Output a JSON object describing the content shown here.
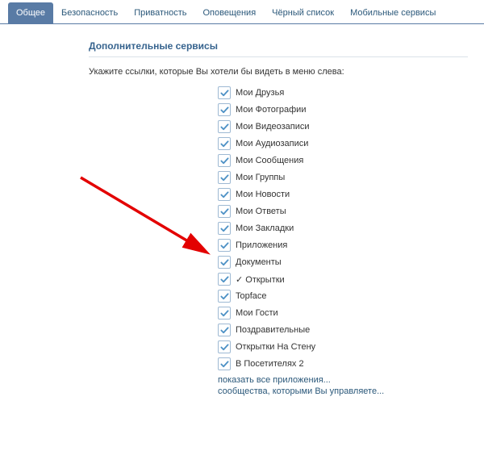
{
  "tabs": [
    {
      "label": "Общее",
      "active": true
    },
    {
      "label": "Безопасность",
      "active": false
    },
    {
      "label": "Приватность",
      "active": false
    },
    {
      "label": "Оповещения",
      "active": false
    },
    {
      "label": "Чёрный список",
      "active": false
    },
    {
      "label": "Мобильные сервисы",
      "active": false
    }
  ],
  "section_title": "Дополнительные сервисы",
  "hint": "Укажите ссылки, которые Вы хотели бы видеть в меню слева:",
  "items": [
    {
      "label": "Мои Друзья",
      "checked": true
    },
    {
      "label": "Мои Фотографии",
      "checked": true
    },
    {
      "label": "Мои Видеозаписи",
      "checked": true
    },
    {
      "label": "Мои Аудиозаписи",
      "checked": true
    },
    {
      "label": "Мои Сообщения",
      "checked": true
    },
    {
      "label": "Мои Группы",
      "checked": true
    },
    {
      "label": "Мои Новости",
      "checked": true
    },
    {
      "label": "Мои Ответы",
      "checked": true
    },
    {
      "label": "Мои Закладки",
      "checked": true
    },
    {
      "label": "Приложения",
      "checked": true
    },
    {
      "label": "Документы",
      "checked": true
    },
    {
      "label": "✓ Открытки",
      "checked": true
    },
    {
      "label": "Topface",
      "checked": true
    },
    {
      "label": "Мои Гости",
      "checked": true
    },
    {
      "label": "Поздравительные",
      "checked": true
    },
    {
      "label": "Открытки На Стену",
      "checked": true
    },
    {
      "label": "В Посетителях 2",
      "checked": true
    }
  ],
  "links": {
    "show_all_apps": "показать все приложения...",
    "communities": "сообщества, которыми Вы управляете..."
  },
  "colors": {
    "tab_active_bg": "#597ba5",
    "link": "#2b587a",
    "title": "#36638e",
    "check_stroke": "#4d91c5"
  }
}
